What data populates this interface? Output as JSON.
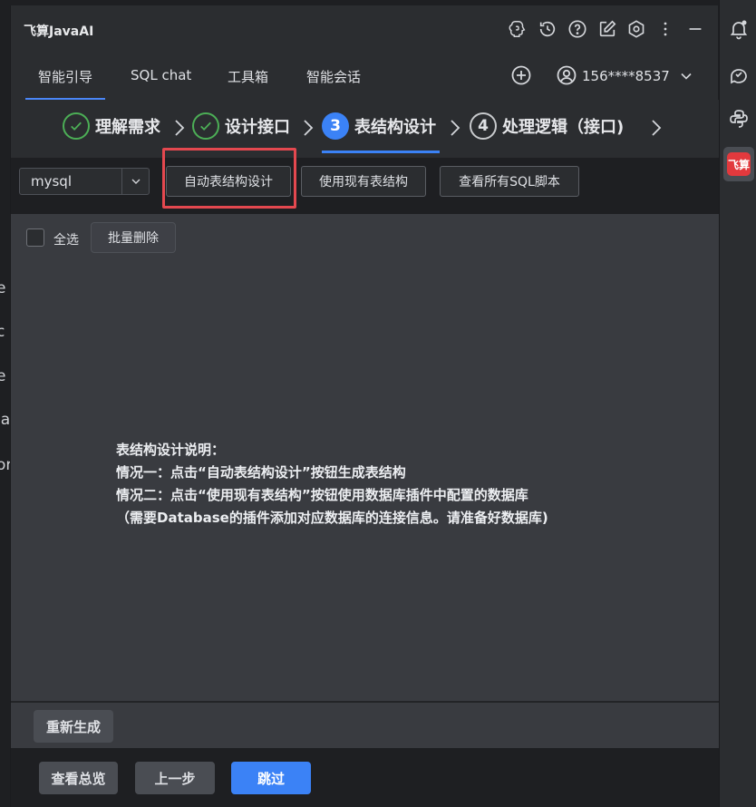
{
  "app": {
    "title": "飞算JavaAI"
  },
  "tabs": [
    {
      "label": "智能引导",
      "active": true
    },
    {
      "label": "SQL chat",
      "active": false
    },
    {
      "label": "工具箱",
      "active": false
    },
    {
      "label": "智能会话",
      "active": false
    }
  ],
  "user": {
    "phone": "156****8537"
  },
  "steps": [
    {
      "label": "理解需求",
      "state": "done",
      "number": ""
    },
    {
      "label": "设计接口",
      "state": "done",
      "number": ""
    },
    {
      "label": "表结构设计",
      "state": "current",
      "number": "3"
    },
    {
      "label": "处理逻辑（接口)",
      "state": "todo",
      "number": "4"
    }
  ],
  "toolbar": {
    "db_select": "mysql",
    "auto_design_label": "自动表结构设计",
    "use_existing_label": "使用现有表结构",
    "view_sql_label": "查看所有SQL脚本"
  },
  "list": {
    "select_all_label": "全选",
    "batch_delete_label": "批量删除"
  },
  "explanation": {
    "title": "表结构设计说明：",
    "line1": "情况一：点击“自动表结构设计”按钮生成表结构",
    "line2": "情况二：点击“使用现有表结构”按钮使用数据库插件中配置的数据库",
    "line3": "（需要Database的插件添加对应数据库的连接信息。请准备好数据库)"
  },
  "regen_label": "重新生成",
  "footer": {
    "overview_label": "查看总览",
    "prev_label": "上一步",
    "skip_label": "跳过"
  },
  "left_strip_chars": [
    "e",
    "c",
    "e",
    "la",
    "or"
  ],
  "right_strip": {
    "logo_text": "飞算"
  },
  "colors": {
    "accent": "#3b82f6",
    "done": "#4cae56",
    "highlight": "#e4484f",
    "logo": "#e2393d"
  },
  "icons": [
    "ai-brain-icon",
    "history-icon",
    "help-icon",
    "edit-icon",
    "settings-icon",
    "more-icon",
    "minimize-icon",
    "plus-circle-icon",
    "user-icon",
    "chevron-down-icon",
    "bell-icon",
    "ai-assistant-icon",
    "python-icon"
  ]
}
